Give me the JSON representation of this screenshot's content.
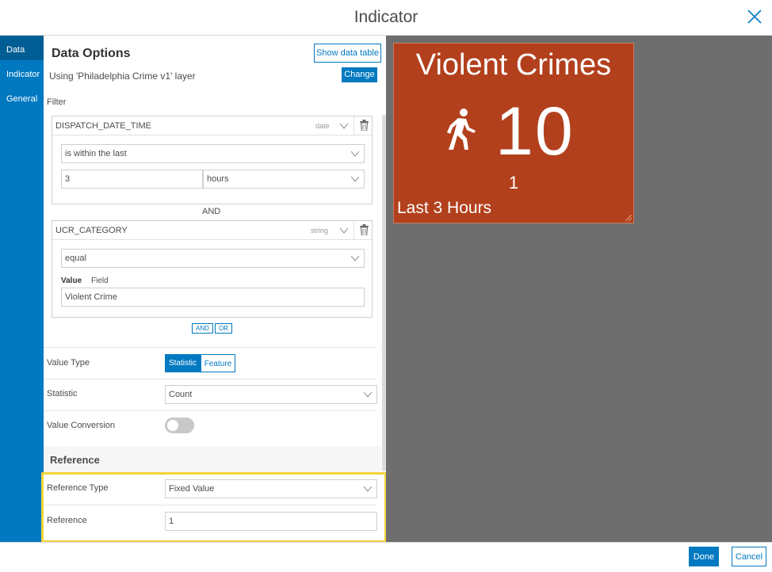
{
  "window": {
    "title": "Indicator"
  },
  "nav": {
    "items": [
      {
        "label": "Data"
      },
      {
        "label": "Indicator"
      },
      {
        "label": "General"
      }
    ]
  },
  "options": {
    "title": "Data Options",
    "show_table_label": "Show data table",
    "layer_text": "Using 'Philadelphia Crime v1' layer",
    "change_label": "Change",
    "filter_label": "Filter",
    "conditions": [
      {
        "field": "DISPATCH_DATE_TIME",
        "type": "date",
        "operator": "is within the last",
        "value": "3",
        "unit": "hours"
      },
      {
        "field": "UCR_CATEGORY",
        "type": "string",
        "operator": "equal",
        "value_tab": "Value",
        "field_tab": "Field",
        "value": "Violent Crime"
      }
    ],
    "and_separator": "AND",
    "add_and_label": "AND",
    "add_or_label": "OR",
    "value_type": {
      "label": "Value Type",
      "options": [
        "Statistic",
        "Feature"
      ]
    },
    "statistic": {
      "label": "Statistic",
      "value": "Count"
    },
    "value_conversion": {
      "label": "Value Conversion"
    },
    "reference": {
      "heading": "Reference",
      "type_label": "Reference Type",
      "type_value": "Fixed Value",
      "value_label": "Reference",
      "value": "1"
    }
  },
  "preview": {
    "title": "Violent Crimes",
    "icon": "walking-person-icon",
    "value": "10",
    "reference_value": "1",
    "bottom_text": "Last 3 Hours"
  },
  "footer": {
    "done_label": "Done",
    "cancel_label": "Cancel"
  },
  "colors": {
    "accent": "#0079c1",
    "card_background": "#b2401d",
    "highlight": "#f2d43c"
  }
}
